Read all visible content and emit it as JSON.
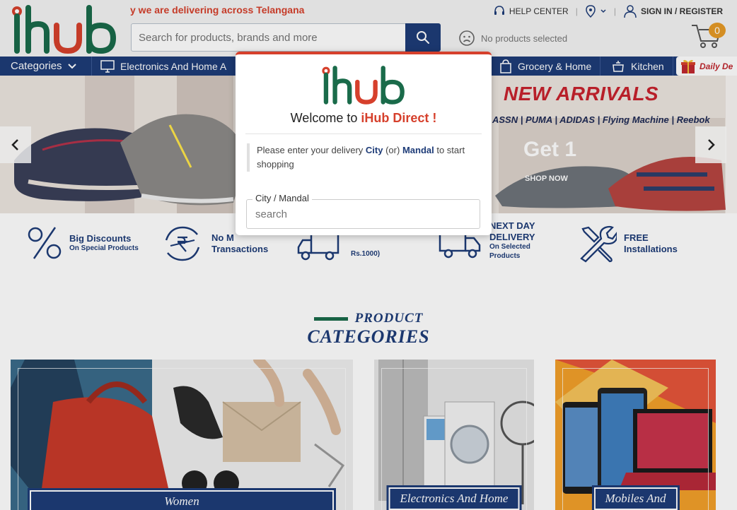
{
  "header": {
    "marquee": "y we are delivering across Telangana",
    "search_placeholder": "Search for products, brands and more",
    "no_products": "No products selected",
    "help_center": "HELP CENTER",
    "sign_in": "SIGN IN / REGISTER",
    "cart_count": "0"
  },
  "nav": {
    "categories": "Categories",
    "items": [
      "Electronics And Home A",
      "Grocery & Home",
      "Kitchen"
    ],
    "daily": "Daily De"
  },
  "banner": {
    "headline": "NEW ARRIVALS",
    "brands": "ASSN | PUMA | ADIDAS | Flying Machine | Reebok",
    "get": "Get 1",
    "shop_now": "SHOP NOW"
  },
  "features": [
    {
      "title": "Big Discounts",
      "sub": "On Special Products"
    },
    {
      "title": "No M",
      "title2": "Transactions",
      "sub": ""
    },
    {
      "title": "",
      "sub": "Rs.1000)"
    },
    {
      "title": "NEXT DAY",
      "title2": "DELIVERY",
      "sub": "On Selected",
      "sub2": "Products"
    },
    {
      "title": "FREE",
      "title2": "Installations",
      "sub": ""
    }
  ],
  "product_categories": {
    "line1": "PRODUCT",
    "line2": "CATEGORIES",
    "cards": [
      {
        "label": "Women"
      },
      {
        "label": "Electronics And Home"
      },
      {
        "label": "Mobiles And"
      }
    ]
  },
  "modal": {
    "welcome_prefix": "Welcome to ",
    "brand": "iHub Direct !",
    "msg_prefix": "Please enter your delivery ",
    "city": "City",
    "or": " (or) ",
    "mandal": "Mandal",
    "msg_suffix": " to start shopping",
    "field_label": "City / Mandal",
    "field_placeholder": "search"
  },
  "colors": {
    "primary": "#1e3c78",
    "accent": "#d6402c",
    "green": "#1a6b4a"
  }
}
